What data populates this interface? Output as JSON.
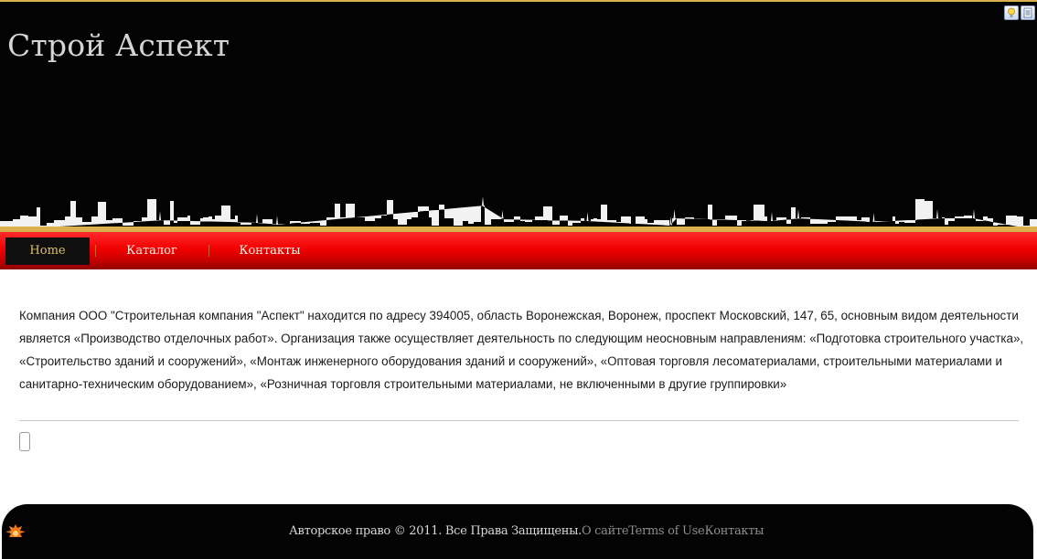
{
  "header": {
    "site_title": "Строй Аспект"
  },
  "nav": {
    "items": [
      {
        "label": "Home"
      },
      {
        "label": "Каталог"
      },
      {
        "label": "Контакты"
      }
    ]
  },
  "main": {
    "paragraph": "Компания ООО \"Строительная компания \"Аспект\" находится по адресу 394005, область Воронежская, Воронеж, проспект Московский, 147, 65, основным видом деятельности является «Производство отделочных работ». Организация также осуществляет деятельность по следующим неосновным направлениям: «Подготовка строительного участка», «Строительство зданий и сооружений», «Монтаж инженерного оборудования зданий и сооружений», «Оптовая торговля лесоматериалами, строительными материалами и санитарно-техническим оборудованием», «Розничная торговля строительными материалами, не включенными в другие группировки»"
  },
  "footer": {
    "copyright": "Авторское право © 2011. Все Права Защищены.",
    "links": [
      "О сайте",
      "Terms of Use",
      "Контакты"
    ]
  },
  "colors": {
    "header_bg": "#030303",
    "nav_red": "#f20000",
    "gold_accent": "#d9b04c",
    "active_nav_text": "#e8c25a"
  }
}
